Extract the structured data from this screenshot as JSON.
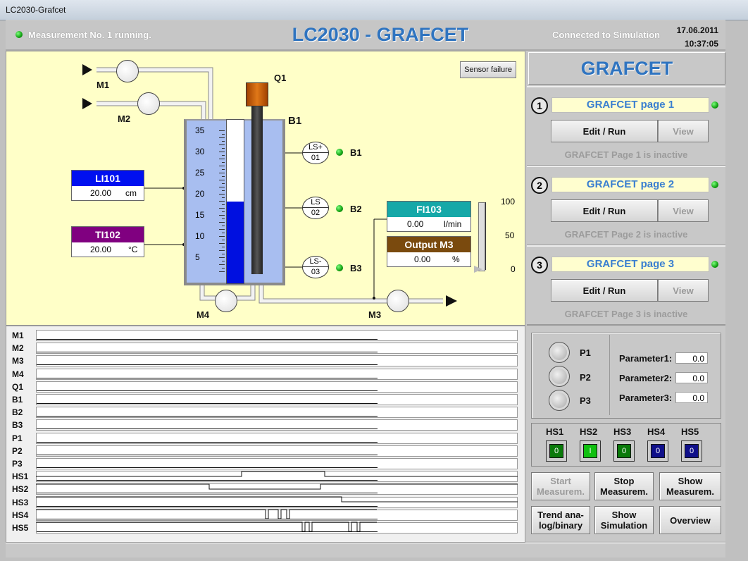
{
  "window": {
    "title": "LC2030-Grafcet"
  },
  "header": {
    "status": "Measurement No. 1 running.",
    "app_title": "LC2030 - GRAFCET",
    "connection": "Connected to Simulation",
    "date": "17.06.2011",
    "time": "10:37:05"
  },
  "process": {
    "sensor_failure_button": "Sensor failure",
    "motors": {
      "m1": "M1",
      "m2": "M2",
      "m3": "M3",
      "m4": "M4"
    },
    "heater": "Q1",
    "tank": {
      "label": "B1",
      "scale": [
        "35",
        "30",
        "25",
        "20",
        "15",
        "10",
        "5"
      ],
      "level": 20,
      "max": 40
    },
    "sensors": [
      {
        "top": "LS+",
        "bottom": "01",
        "label": "B1"
      },
      {
        "top": "LS",
        "bottom": "02",
        "label": "B2"
      },
      {
        "top": "LS-",
        "bottom": "03",
        "label": "B3"
      }
    ],
    "li101": {
      "tag": "LI101",
      "value": "20.00",
      "unit": "cm"
    },
    "ti102": {
      "tag": "TI102",
      "value": "20.00",
      "unit": "°C"
    },
    "fi103": {
      "tag": "FI103",
      "value": "0.00",
      "unit": "l/min"
    },
    "output_m3": {
      "tag": "Output M3",
      "value": "0.00",
      "unit": "%"
    },
    "gauge_scale": [
      "100",
      "50",
      "0"
    ],
    "gauge_level": 0
  },
  "trend": {
    "rows": [
      "M1",
      "M2",
      "M3",
      "M4",
      "Q1",
      "B1",
      "B2",
      "B3",
      "P1",
      "P2",
      "P3",
      "HS1",
      "HS2",
      "HS3",
      "HS4",
      "HS5"
    ]
  },
  "grafcet": {
    "title": "GRAFCET",
    "pages": [
      {
        "num": "1",
        "name": "GRAFCET page 1",
        "edit": "Edit / Run",
        "view": "View",
        "status": "GRAFCET Page 1 is inactive"
      },
      {
        "num": "2",
        "name": "GRAFCET page 2",
        "edit": "Edit / Run",
        "view": "View",
        "status": "GRAFCET Page 2 is inactive"
      },
      {
        "num": "3",
        "name": "GRAFCET page 3",
        "edit": "Edit / Run",
        "view": "View",
        "status": "GRAFCET Page 3 is inactive"
      }
    ]
  },
  "params": {
    "buttons": [
      "P1",
      "P2",
      "P3"
    ],
    "fields": [
      {
        "label": "Parameter1:",
        "value": "0.0"
      },
      {
        "label": "Parameter2:",
        "value": "0.0"
      },
      {
        "label": "Parameter3:",
        "value": "0.0"
      }
    ]
  },
  "hs": [
    {
      "label": "HS1",
      "value": "0",
      "color": "#0a7a0a"
    },
    {
      "label": "HS2",
      "value": "I",
      "color": "#10c010"
    },
    {
      "label": "HS3",
      "value": "0",
      "color": "#0a7a0a"
    },
    {
      "label": "HS4",
      "value": "0",
      "color": "#10108a"
    },
    {
      "label": "HS5",
      "value": "0",
      "color": "#10108a"
    }
  ],
  "actions": {
    "start": "Start Measurem.",
    "stop": "Stop Measurem.",
    "show": "Show Measurem.",
    "trend": "Trend ana-log/binary",
    "simulation": "Show Simulation",
    "overview": "Overview"
  }
}
